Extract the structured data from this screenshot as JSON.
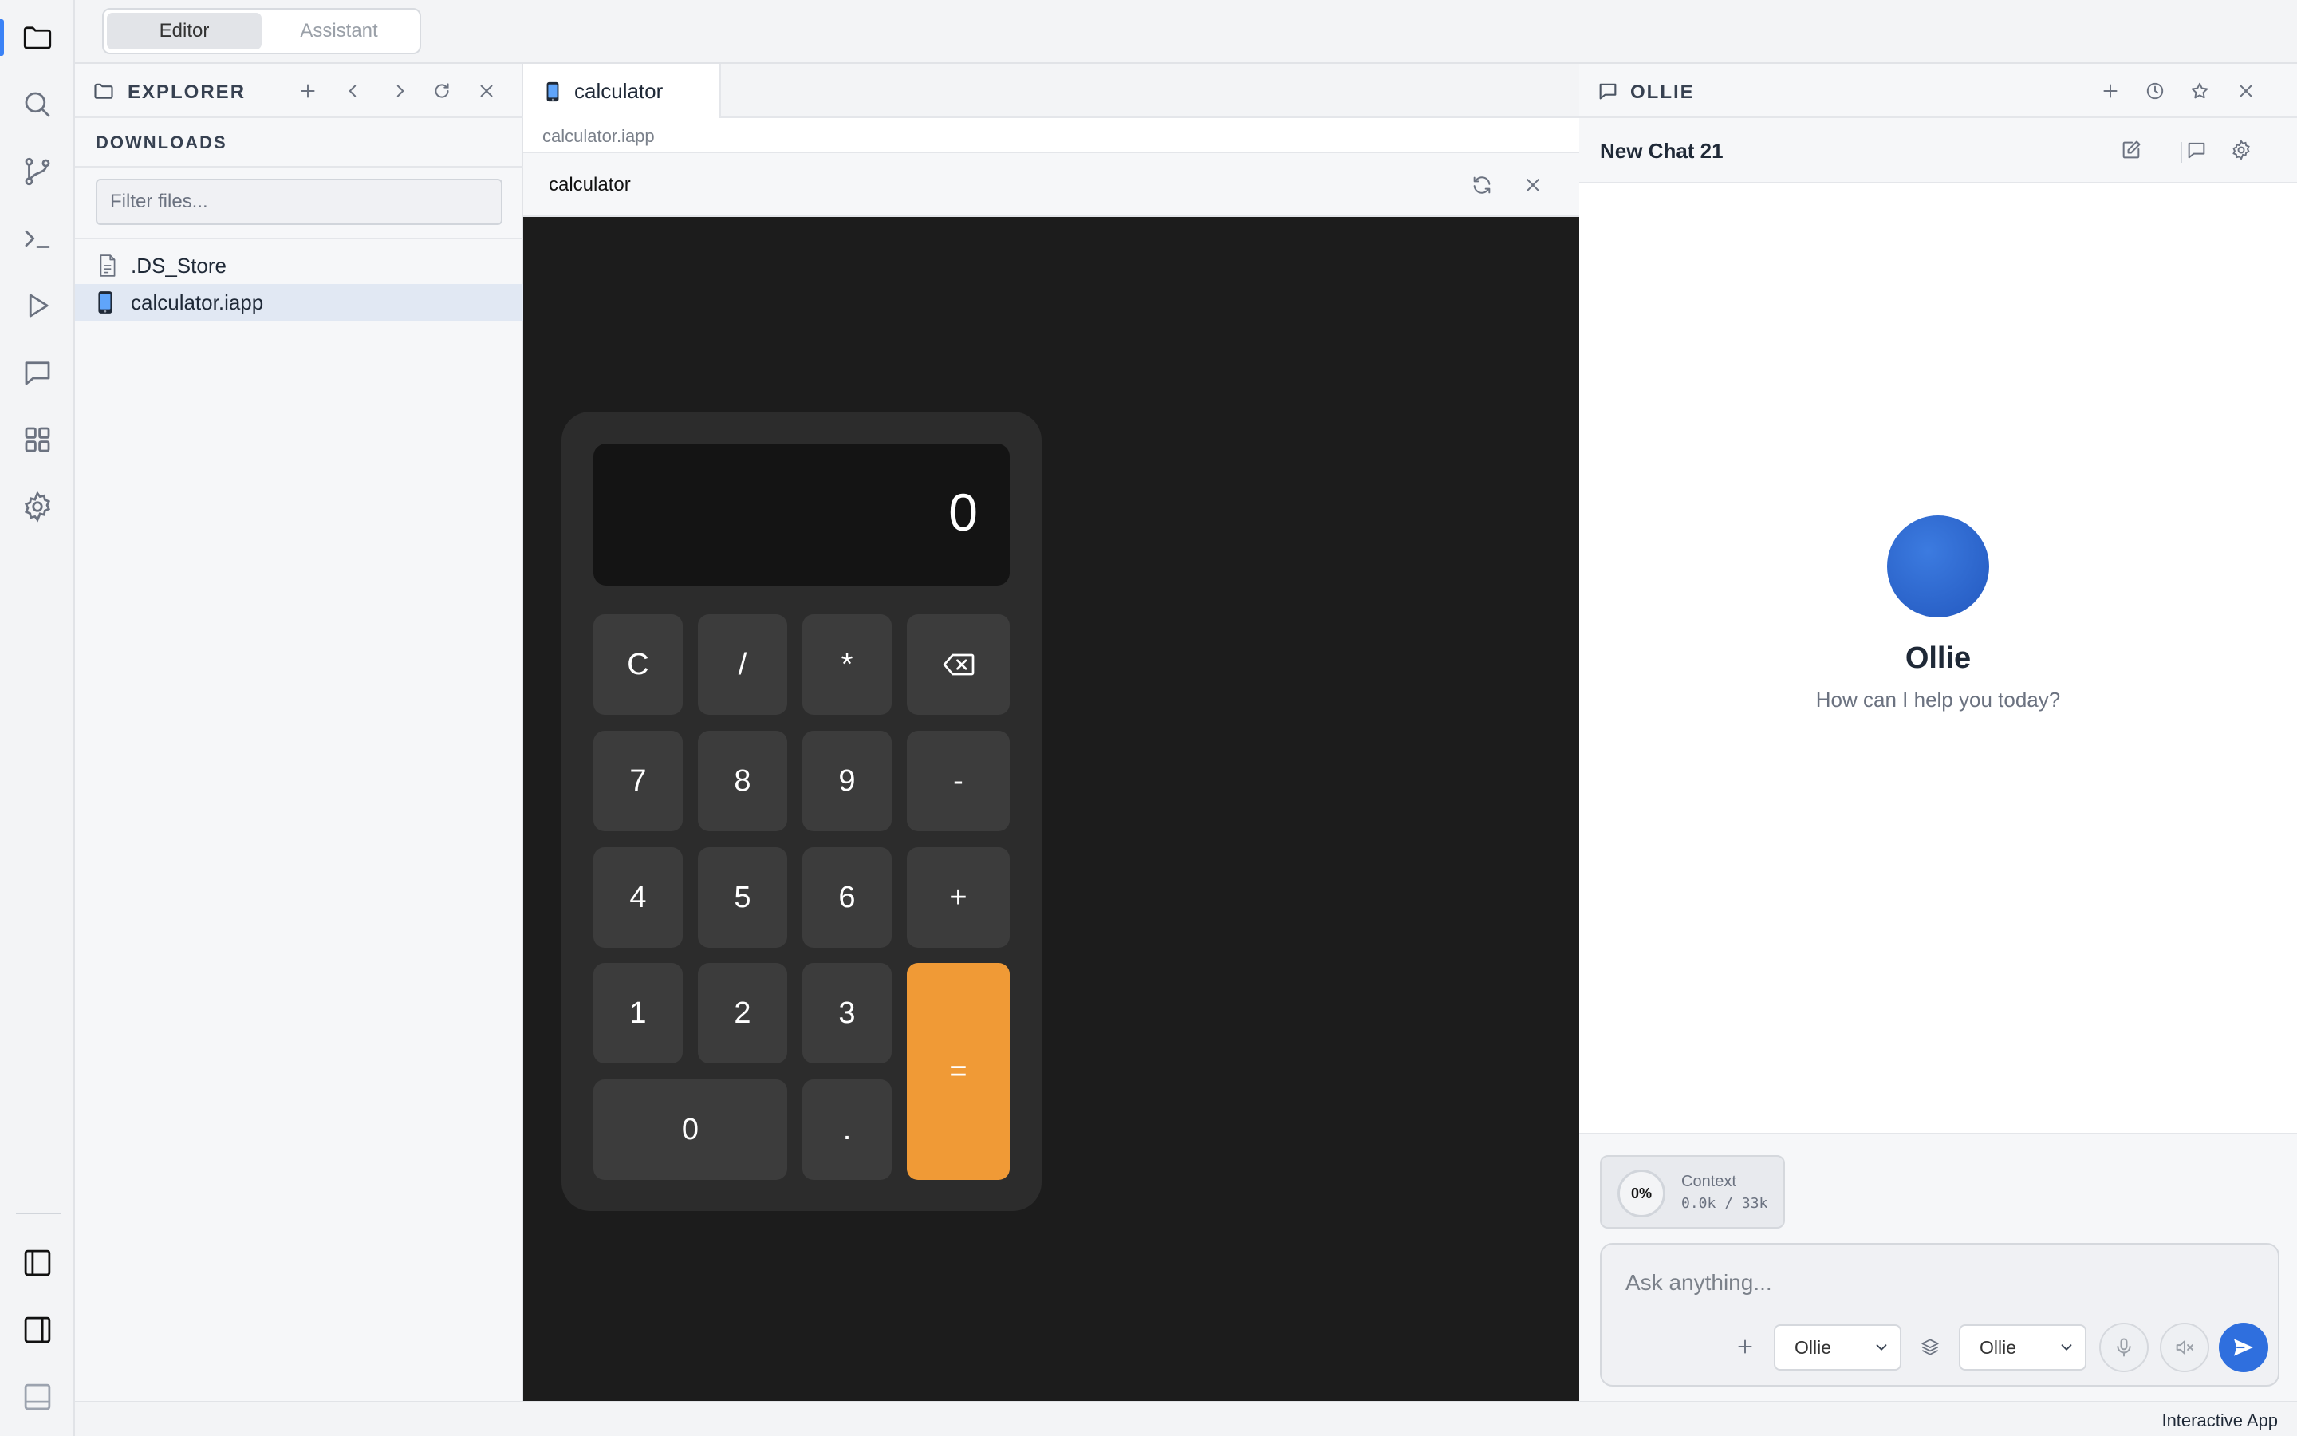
{
  "top_bar": {
    "modes": [
      {
        "label": "Editor",
        "active": true
      },
      {
        "label": "Assistant",
        "active": false
      }
    ]
  },
  "activity_bar": {
    "items": [
      "folder-icon",
      "search-icon",
      "source-control-icon",
      "terminal-icon",
      "run-icon",
      "chat-icon",
      "extensions-icon",
      "settings-icon"
    ],
    "bottom_items": [
      "toggle-left-panel-icon",
      "toggle-right-panel-icon",
      "toggle-bottom-panel-icon"
    ],
    "accent": "#3b82f6"
  },
  "explorer": {
    "title": "EXPLORER",
    "section": "DOWNLOADS",
    "filter_placeholder": "Filter files...",
    "files": [
      {
        "name": ".DS_Store",
        "icon": "file-icon",
        "selected": false
      },
      {
        "name": "calculator.iapp",
        "icon": "phone-icon",
        "selected": true
      }
    ]
  },
  "editor": {
    "tab_label": "calculator",
    "breadcrumb": "calculator.iapp",
    "app_title": "calculator"
  },
  "calculator": {
    "display": "0",
    "keys": {
      "clear": "C",
      "divide": "/",
      "multiply": "*",
      "backspace": "backspace-icon",
      "seven": "7",
      "eight": "8",
      "nine": "9",
      "minus": "-",
      "four": "4",
      "five": "5",
      "six": "6",
      "plus": "+",
      "one": "1",
      "two": "2",
      "three": "3",
      "equals": "=",
      "zero": "0",
      "decimal": "."
    },
    "colors": {
      "body": "#2c2c2c",
      "key": "#3c3c3c",
      "equals": "#f09a36",
      "display": "#141414"
    }
  },
  "assistant": {
    "panel_title": "OLLIE",
    "chat_title": "New Chat 21",
    "agent_name": "Ollie",
    "greeting": "How can I help you today?",
    "context": {
      "percent": "0%",
      "label": "Context",
      "value": "0.0k / 33k"
    },
    "input_placeholder": "Ask anything...",
    "agent_select": "Ollie",
    "model_select": "Ollie",
    "accent": "#2f6fde"
  },
  "status_bar": {
    "text": "Interactive App"
  }
}
